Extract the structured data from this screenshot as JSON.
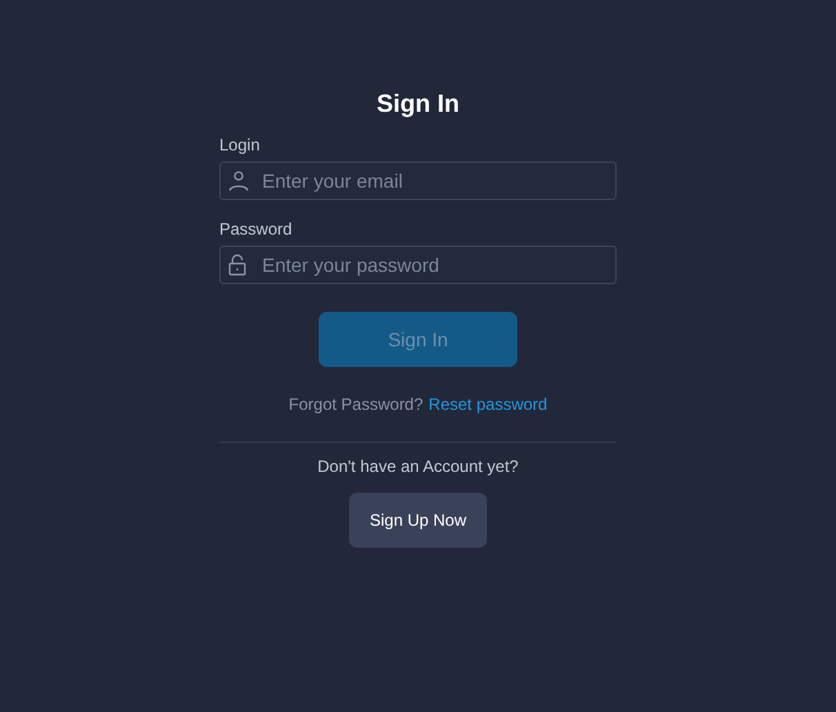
{
  "title": "Sign In",
  "fields": [
    {
      "kind": "email",
      "label": "Login",
      "placeholder": "Enter your email"
    },
    {
      "kind": "password",
      "label": "Password",
      "placeholder": "Enter your password"
    }
  ],
  "submit": {
    "label": "Sign In",
    "disabled": true
  },
  "forgot": {
    "text": "Forgot Password?",
    "link": "Reset password"
  },
  "signup": {
    "prompt": "Don't have an Account yet?",
    "button": "Sign Up Now"
  }
}
